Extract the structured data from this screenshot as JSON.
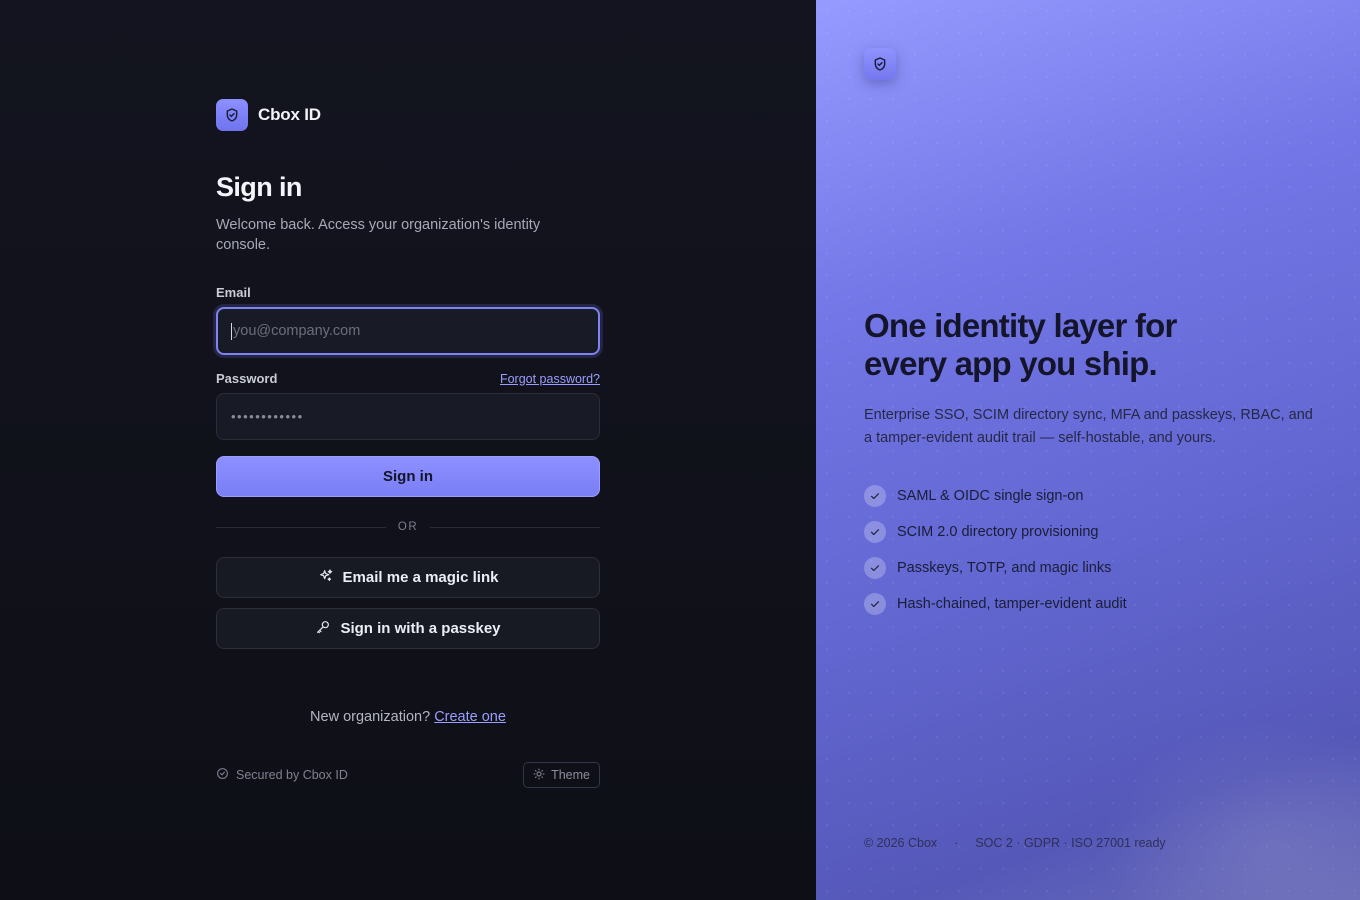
{
  "brand": {
    "name": "Cbox ID",
    "logo_icon": "shield-check-icon"
  },
  "signin": {
    "title": "Sign in",
    "subtitle": "Welcome back. Access your organization's identity console.",
    "email_label": "Email",
    "email_placeholder": "you@company.com",
    "password_label": "Password",
    "forgot_link": "Forgot password?",
    "password_value": "••••••••••••",
    "submit_label": "Sign in",
    "divider_text": "OR",
    "magic_link_label": "Email me a magic link",
    "passkey_label": "Sign in with a passkey",
    "new_org_text": "New organization?",
    "create_link": "Create one",
    "secured_text": "Secured by Cbox ID",
    "theme_label": "Theme"
  },
  "hero": {
    "headline_line1": "One identity layer for",
    "headline_line2": "every app you ship.",
    "description": "Enterprise SSO, SCIM directory sync, MFA and passkeys, RBAC, and a tamper-evident audit trail — self-hostable, and yours.",
    "features": [
      "SAML & OIDC single sign-on",
      "SCIM 2.0 directory provisioning",
      "Passkeys, TOTP, and magic links",
      "Hash-chained, tamper-evident audit"
    ],
    "footer_copyright": "© 2026 Cbox",
    "footer_separator": "·",
    "footer_compliance": "SOC 2 · GDPR · ISO 27001 ready"
  },
  "colors": {
    "accent": "#7d82f5",
    "background": "#0f1017",
    "link": "#9a9eff"
  }
}
